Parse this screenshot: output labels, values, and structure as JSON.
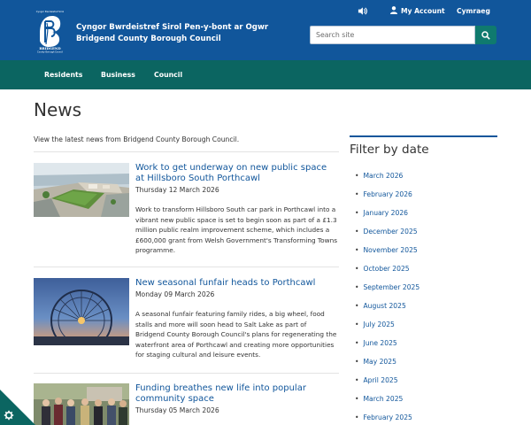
{
  "header": {
    "council_name_welsh": "Cyngor Bwrdeistref Sirol Pen-y-bont ar Ogwr",
    "council_name_english": "Bridgend County Borough Council",
    "logo_alt": "Bridgend County Borough Council logo",
    "sound_icon": "speaker-icon",
    "account_label": "My Account",
    "language_label": "Cymraeg",
    "search_placeholder": "Search site",
    "search_icon": "search-icon"
  },
  "nav": {
    "items": [
      "Residents",
      "Business",
      "Council"
    ]
  },
  "main": {
    "title": "News",
    "intro": "View the latest news from Bridgend County Borough Council.",
    "articles": [
      {
        "title": "Work to get underway on new public space at Hillsboro South Porthcawl",
        "date": "Thursday 12 March 2026",
        "summary": "Work to transform Hillsboro South car park in Porthcawl into a vibrant new public space is set to begin soon as part of a £1.3 million public realm improvement scheme, which includes a £600,000 grant from Welsh Government's Transforming Towns programme."
      },
      {
        "title": "New seasonal funfair heads to Porthcawl",
        "date": "Monday 09 March 2026",
        "summary": "A seasonal funfair featuring family rides, a big wheel, food stalls and more will soon head to Salt Lake as part of Bridgend County Borough Council's plans for regenerating the waterfront area of Porthcawl and creating more opportunities for staging cultural and leisure events."
      },
      {
        "title": "Funding breathes new life into popular community space",
        "date": "Thursday 05 March 2026",
        "summary": ""
      }
    ]
  },
  "sidebar": {
    "heading": "Filter by date",
    "dates": [
      "March 2026",
      "February 2026",
      "January 2026",
      "December 2025",
      "November 2025",
      "October 2025",
      "September 2025",
      "August 2025",
      "July 2025",
      "June 2025",
      "May 2025",
      "April 2025",
      "March 2025",
      "February 2025"
    ]
  },
  "colors": {
    "header_blue": "#11569b",
    "nav_teal": "#0b6561",
    "search_button": "#0f7a6e",
    "link_blue": "#11569b"
  },
  "cookie": {
    "icon": "gear-icon"
  }
}
